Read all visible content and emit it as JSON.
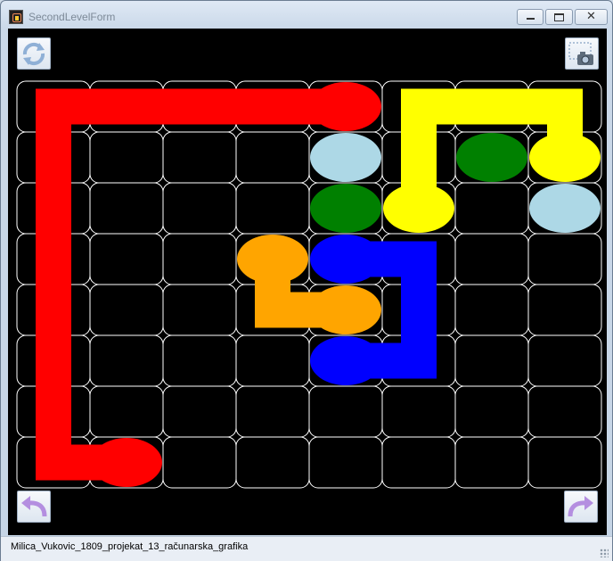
{
  "window": {
    "title": "SecondLevelForm",
    "close_glyph": "✕"
  },
  "toolbar": {
    "reset_icon": "refresh-icon",
    "screenshot_icon": "camera-icon",
    "undo_icon": "undo-arrow-icon",
    "redo_icon": "redo-arrow-icon"
  },
  "board": {
    "rows": 8,
    "cols": 8,
    "grid_color": "#ffffff",
    "background": "#000000",
    "dots": [
      {
        "color": "red",
        "row": 0,
        "col": 4
      },
      {
        "color": "lightblue",
        "row": 1,
        "col": 4
      },
      {
        "color": "green",
        "row": 1,
        "col": 6
      },
      {
        "color": "yellow",
        "row": 1,
        "col": 7
      },
      {
        "color": "green",
        "row": 2,
        "col": 4
      },
      {
        "color": "yellow",
        "row": 2,
        "col": 5
      },
      {
        "color": "lightblue",
        "row": 2,
        "col": 7
      },
      {
        "color": "orange",
        "row": 3,
        "col": 3
      },
      {
        "color": "blue",
        "row": 3,
        "col": 4
      },
      {
        "color": "orange",
        "row": 4,
        "col": 4
      },
      {
        "color": "blue",
        "row": 5,
        "col": 4
      },
      {
        "color": "red",
        "row": 7,
        "col": 1
      }
    ],
    "paths": [
      {
        "color": "red",
        "cells": [
          [
            0,
            4
          ],
          [
            0,
            3
          ],
          [
            0,
            2
          ],
          [
            0,
            1
          ],
          [
            0,
            0
          ],
          [
            1,
            0
          ],
          [
            2,
            0
          ],
          [
            3,
            0
          ],
          [
            4,
            0
          ],
          [
            5,
            0
          ],
          [
            6,
            0
          ],
          [
            7,
            0
          ],
          [
            7,
            1
          ]
        ]
      },
      {
        "color": "yellow",
        "cells": [
          [
            2,
            5
          ],
          [
            1,
            5
          ],
          [
            0,
            5
          ],
          [
            0,
            6
          ],
          [
            0,
            7
          ],
          [
            1,
            7
          ]
        ]
      },
      {
        "color": "blue",
        "cells": [
          [
            3,
            4
          ],
          [
            3,
            5
          ],
          [
            4,
            5
          ],
          [
            5,
            5
          ],
          [
            5,
            4
          ]
        ]
      },
      {
        "color": "orange",
        "cells": [
          [
            3,
            3
          ],
          [
            4,
            3
          ],
          [
            4,
            4
          ]
        ]
      }
    ],
    "colors": {
      "red": "#ff0000",
      "yellow": "#ffff00",
      "blue": "#0000ff",
      "orange": "#ffa500",
      "green": "#008000",
      "lightblue": "#add8e6"
    }
  },
  "status": {
    "text": "Milica_Vukovic_1809_projekat_13_računarska_grafika"
  }
}
